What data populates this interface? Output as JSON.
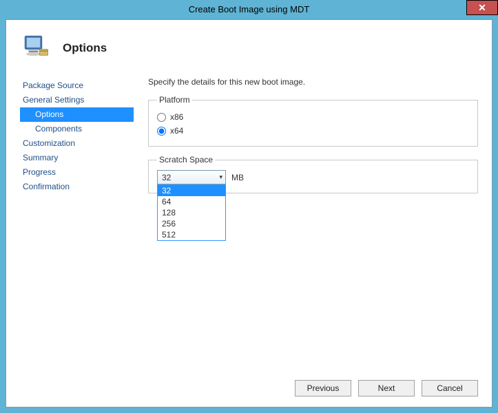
{
  "titlebar": {
    "title": "Create Boot Image using MDT"
  },
  "header": {
    "title": "Options"
  },
  "sidebar": {
    "items": [
      {
        "label": "Package Source",
        "child": false,
        "selected": false
      },
      {
        "label": "General Settings",
        "child": false,
        "selected": false
      },
      {
        "label": "Options",
        "child": true,
        "selected": true
      },
      {
        "label": "Components",
        "child": true,
        "selected": false
      },
      {
        "label": "Customization",
        "child": false,
        "selected": false
      },
      {
        "label": "Summary",
        "child": false,
        "selected": false
      },
      {
        "label": "Progress",
        "child": false,
        "selected": false
      },
      {
        "label": "Confirmation",
        "child": false,
        "selected": false
      }
    ]
  },
  "content": {
    "instruction": "Specify the details for this new boot image.",
    "platform": {
      "legend": "Platform",
      "options": [
        {
          "label": "x86",
          "checked": false
        },
        {
          "label": "x64",
          "checked": true
        }
      ]
    },
    "scratch": {
      "legend": "Scratch Space",
      "value": "32",
      "unit": "MB",
      "options": [
        "32",
        "64",
        "128",
        "256",
        "512"
      ],
      "highlighted": "32"
    }
  },
  "footer": {
    "previous": "Previous",
    "next": "Next",
    "cancel": "Cancel"
  }
}
